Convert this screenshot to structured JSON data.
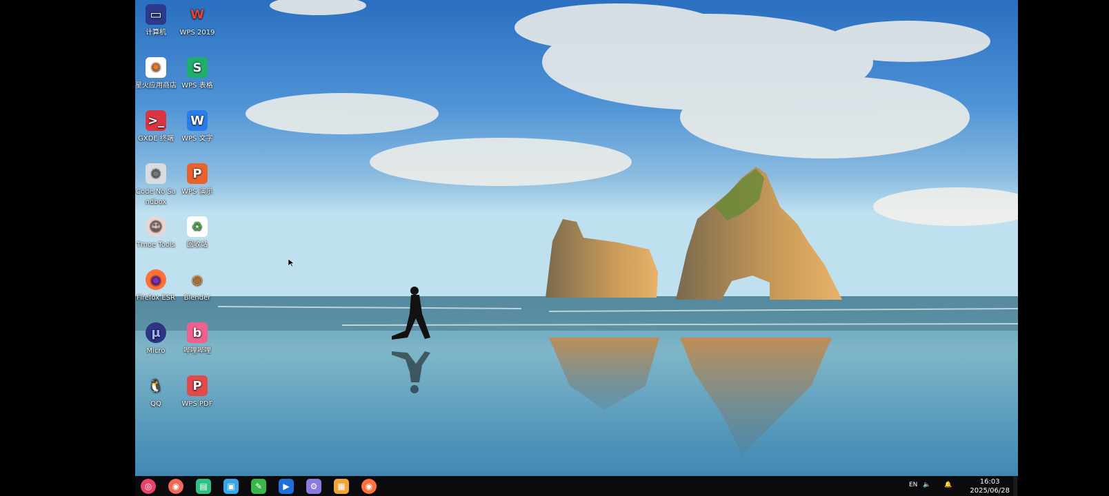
{
  "desktop_icons": [
    {
      "label": "计算机",
      "icon": "computer-icon"
    },
    {
      "label": "WPS 2019",
      "icon": "wps-office-icon"
    },
    {
      "label": "星火应用商店",
      "icon": "spark-store-icon"
    },
    {
      "label": "WPS 表格",
      "icon": "wps-spreadsheet-icon"
    },
    {
      "label": "GXDE 终端",
      "icon": "terminal-icon"
    },
    {
      "label": "WPS 文字",
      "icon": "wps-writer-icon"
    },
    {
      "label": "Code No Sandbox",
      "icon": "code-gear-icon"
    },
    {
      "label": "WPS 演示",
      "icon": "wps-presentation-icon"
    },
    {
      "label": "Tmoe Tools",
      "icon": "tmoe-avatar-icon"
    },
    {
      "label": "回收站",
      "icon": "recycle-bin-icon"
    },
    {
      "label": "Firefox ESR",
      "icon": "firefox-icon"
    },
    {
      "label": "Blender",
      "icon": "blender-icon"
    },
    {
      "label": "Micro",
      "icon": "micro-editor-icon"
    },
    {
      "label": "哔哩哔哩",
      "icon": "bilibili-icon"
    },
    {
      "label": "QQ",
      "icon": "qq-penguin-icon"
    },
    {
      "label": "WPS PDF",
      "icon": "wps-pdf-icon"
    }
  ],
  "taskbar": {
    "apps": [
      {
        "icon": "launcher-icon",
        "color": "#e9436a"
      },
      {
        "icon": "screenshot-icon",
        "color": "#f06a5a"
      },
      {
        "icon": "terminal-icon",
        "color": "#2fc184"
      },
      {
        "icon": "app-store-icon",
        "color": "#37a6ea"
      },
      {
        "icon": "editor-icon",
        "color": "#39b54a"
      },
      {
        "icon": "video-player-icon",
        "color": "#1f6fd6"
      },
      {
        "icon": "settings-gear-icon",
        "color": "#8a7be0"
      },
      {
        "icon": "image-viewer-icon",
        "color": "#f2a33a"
      },
      {
        "icon": "firefox-icon",
        "color": "#ff7139"
      }
    ],
    "tray": {
      "keyboard": "EN",
      "clock_time": "16:03",
      "clock_date": "2025/06/28"
    }
  }
}
